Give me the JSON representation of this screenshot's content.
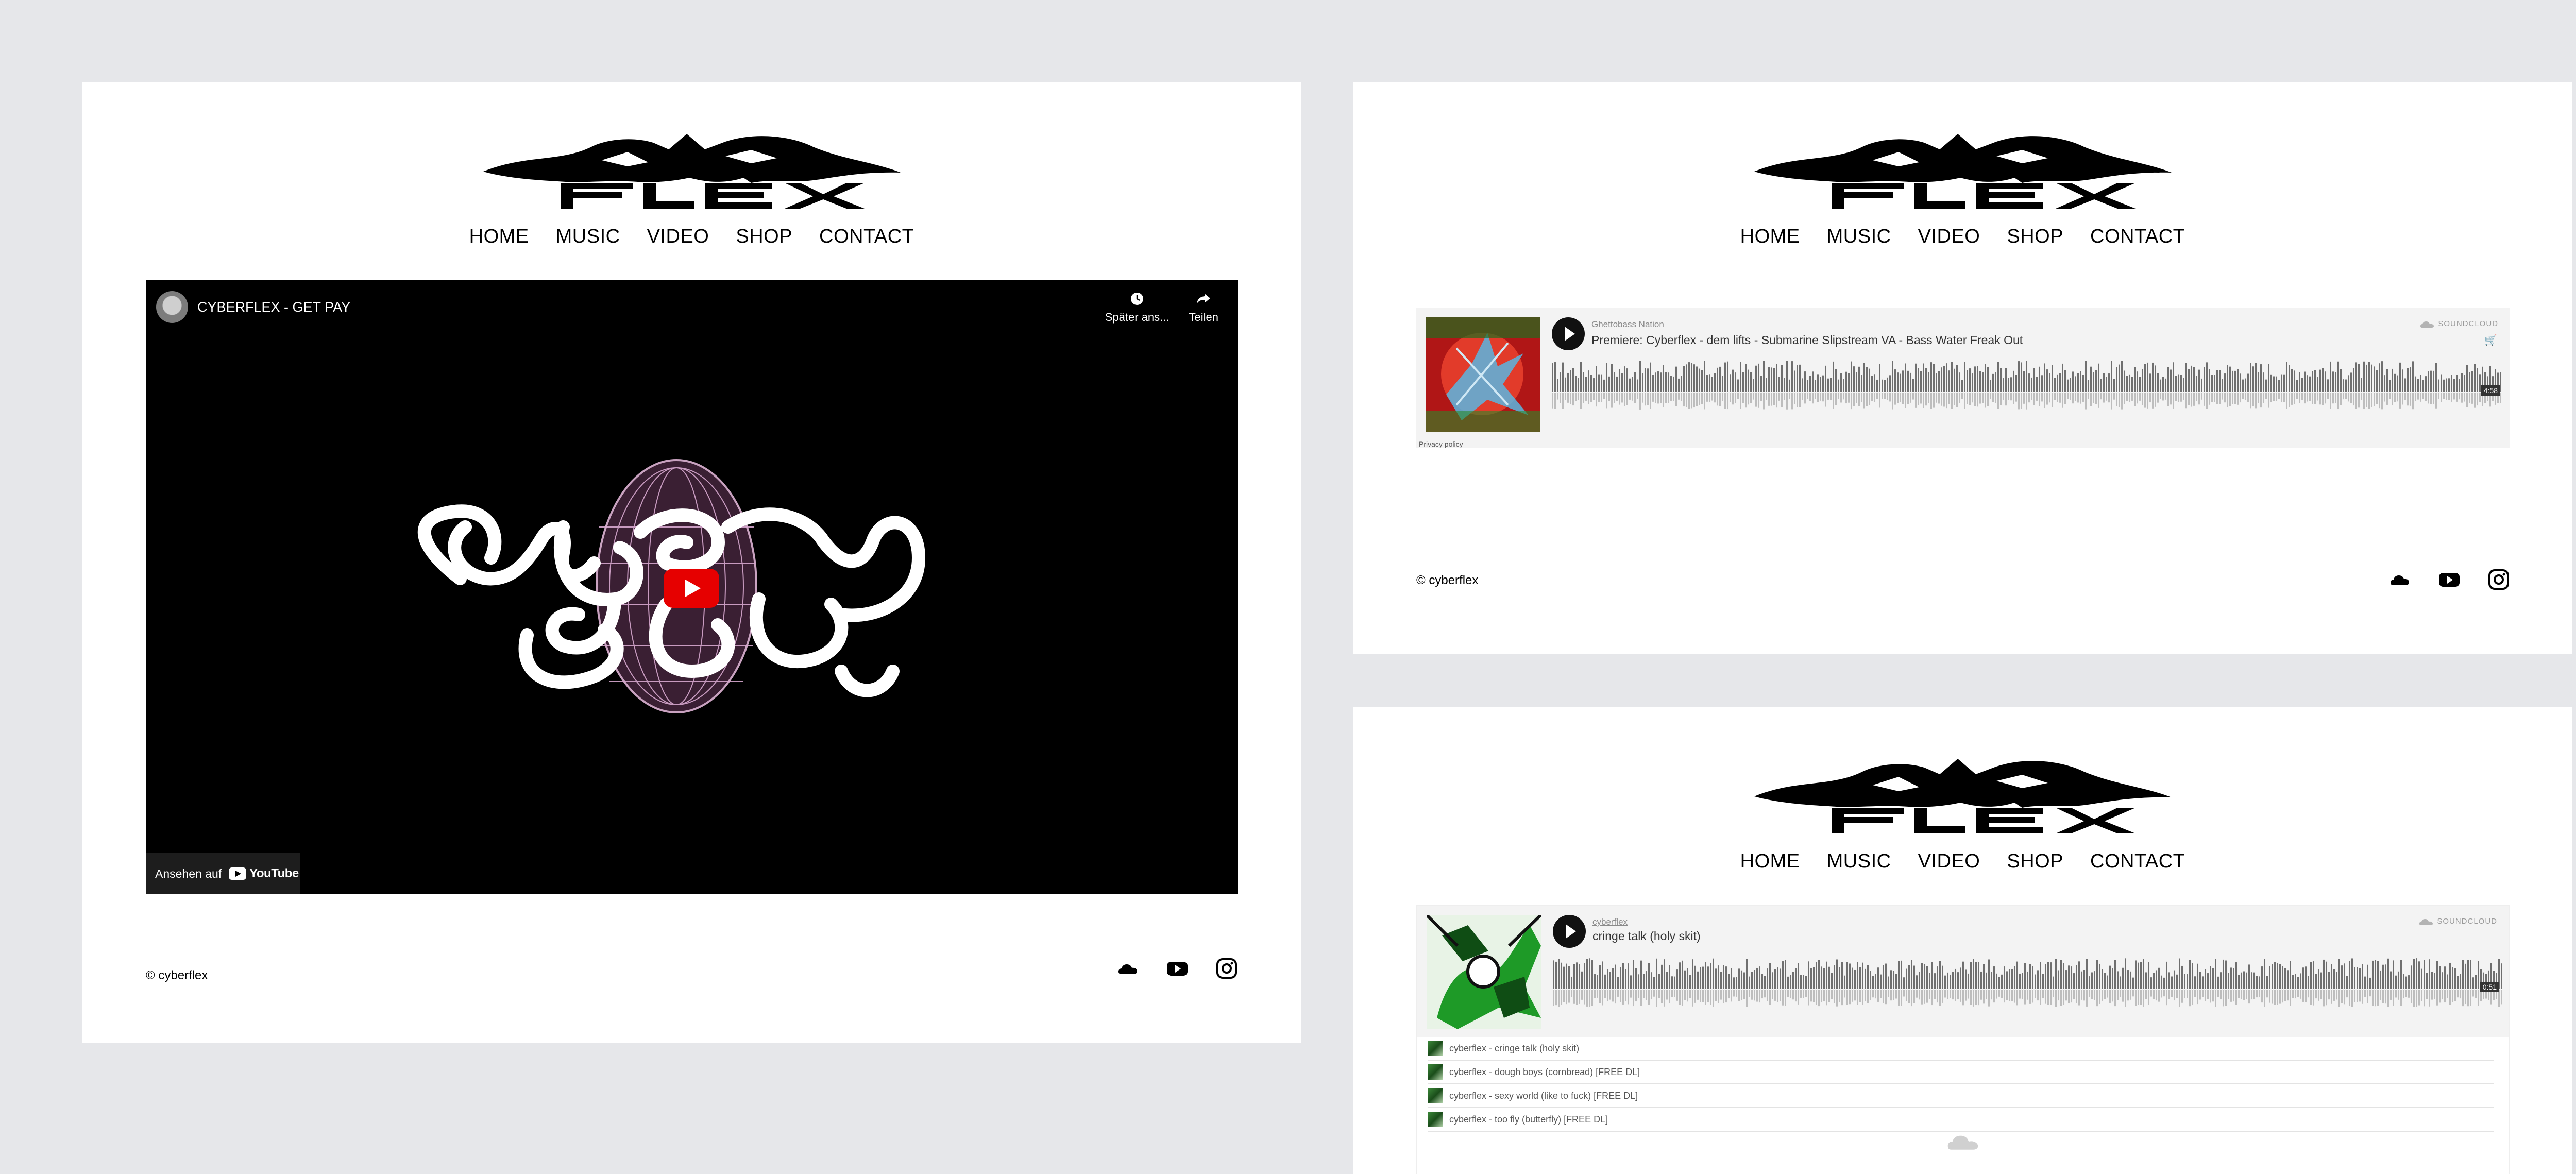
{
  "brand": {
    "logo_text": "CYBER FLEX"
  },
  "nav": [
    "HOME",
    "MUSIC",
    "VIDEO",
    "SHOP",
    "CONTACT"
  ],
  "video_page": {
    "video": {
      "title": "CYBERFLEX - GET PAY",
      "watch_later": "Später ans...",
      "share": "Teilen",
      "watch_on": "Ansehen auf",
      "youtube": "YouTube"
    }
  },
  "footer": {
    "copyright": "© cyberflex",
    "icons": [
      "soundcloud-icon",
      "youtube-icon",
      "instagram-icon"
    ]
  },
  "track_page": {
    "player": {
      "brand": "SOUNDCLOUD",
      "user": "Ghettobass Nation",
      "track": "Premiere: Cyberflex - dem lifts - Submarine Slipstream VA - Bass Water Freak Out",
      "time": "4:58",
      "privacy": "Privacy policy"
    }
  },
  "playlist_page": {
    "player": {
      "brand": "SOUNDCLOUD",
      "user": "cyberflex",
      "track": "cringe talk (holy skit)",
      "time": "0:51"
    },
    "tracks": [
      "cyberflex - cringe talk (holy skit)",
      "cyberflex - dough boys (cornbread) [FREE DL]",
      "cyberflex - sexy world (like to fuck) [FREE DL]",
      "cyberflex - too fly (butterfly) [FREE DL]"
    ]
  }
}
